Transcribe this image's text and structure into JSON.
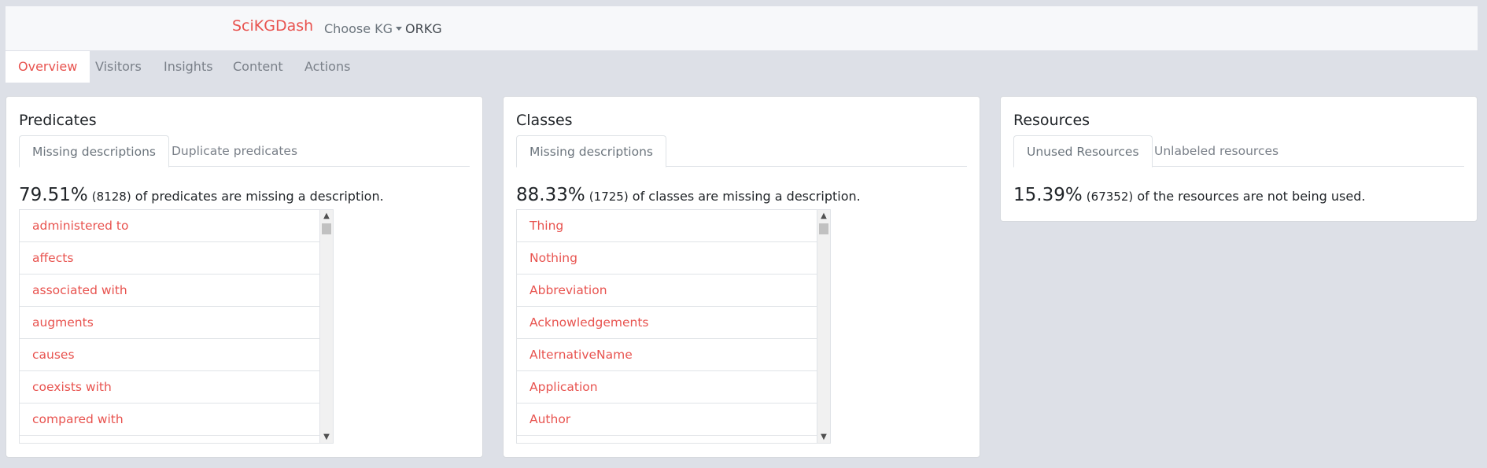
{
  "navbar": {
    "brand": "SciKGDash",
    "choose_kg_label": "Choose KG",
    "selected_kg": "ORKG"
  },
  "top_tabs": [
    {
      "label": "Overview",
      "active": true
    },
    {
      "label": "Visitors"
    },
    {
      "label": "Insights"
    },
    {
      "label": "Content"
    },
    {
      "label": "Actions"
    }
  ],
  "predicates": {
    "title": "Predicates",
    "tabs": [
      {
        "label": "Missing descriptions",
        "active": true
      },
      {
        "label": "Duplicate predicates"
      }
    ],
    "percent": "79.51%",
    "count": "(8128)",
    "text": "of predicates are missing a description.",
    "items": [
      "administered to",
      "affects",
      "associated with",
      "augments",
      "causes",
      "coexists with",
      "compared with"
    ]
  },
  "classes": {
    "title": "Classes",
    "tabs": [
      {
        "label": "Missing descriptions",
        "active": true
      }
    ],
    "percent": "88.33%",
    "count": "(1725)",
    "text": "of classes are missing a description.",
    "items": [
      "Thing",
      "Nothing",
      "Abbreviation",
      "Acknowledgements",
      "AlternativeName",
      "Application",
      "Author"
    ]
  },
  "resources": {
    "title": "Resources",
    "tabs": [
      {
        "label": "Unused Resources",
        "active": true
      },
      {
        "label": "Unlabeled resources"
      }
    ],
    "percent": "15.39%",
    "count": "(67352)",
    "text": "of the resources are not being used."
  },
  "colors": {
    "accent": "#e8534f",
    "background": "#dde0e7",
    "muted": "#7a8089"
  }
}
